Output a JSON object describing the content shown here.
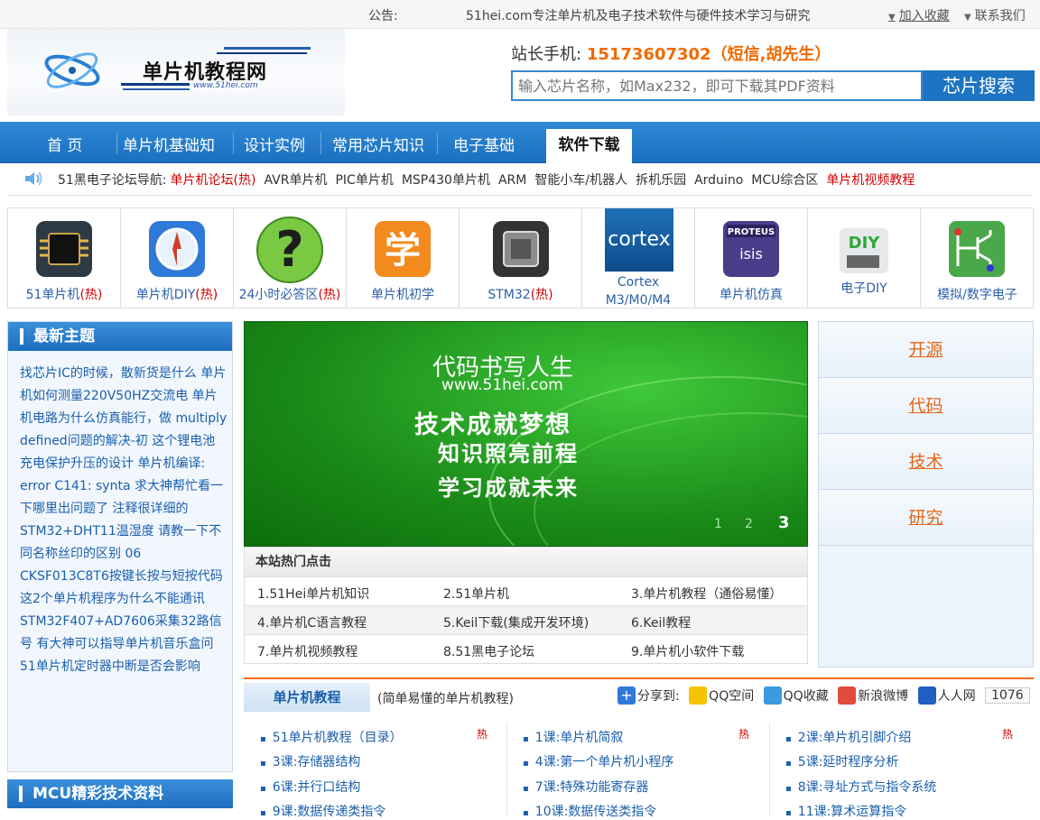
{
  "topbar": {
    "notice_label": "公告:",
    "notice_text": "51hei.com专注单片机及电子技术软件与硬件技术学习与研究",
    "add_favorite": "加入收藏",
    "contact": "联系我们"
  },
  "logo": {
    "name": "单片机教程网",
    "url_text": "www.51hei.com"
  },
  "contact_line": {
    "label": "站长手机:",
    "value": "15173607302（短信,胡先生）"
  },
  "search": {
    "placeholder": "输入芯片名称，如Max232，即可下载其PDF资料",
    "button": "芯片搜索"
  },
  "nav": {
    "items": [
      "首 页",
      "单片机基础知",
      "设计实例",
      "常用芯片知识",
      "电子基础"
    ],
    "active": "软件下载"
  },
  "forum_nav": {
    "label": "51黑电子论坛导航:",
    "links": [
      "单片机论坛(热)",
      "AVR单片机",
      "PIC单片机",
      "MSP430单片机",
      "ARM",
      "智能小车/机器人",
      "拆机乐园",
      "Arduino",
      "MCU综合区",
      "单片机视频教程"
    ]
  },
  "icon_row": [
    {
      "label": "51单片机",
      "hot": "(热)"
    },
    {
      "label": "单片机DIY",
      "hot": "(热)"
    },
    {
      "label": "24小时必答区",
      "hot": "(热)"
    },
    {
      "label": "单片机初学",
      "hot": ""
    },
    {
      "label": "STM32",
      "hot": "(热)"
    },
    {
      "label": "Cortex M3/M0/M4",
      "hot": ""
    },
    {
      "label": "单片机仿真",
      "hot": ""
    },
    {
      "label": "电子DIY",
      "hot": ""
    },
    {
      "label": "模拟/数字电子",
      "hot": ""
    }
  ],
  "icon_glyphs": {
    "xue": "学",
    "cortex": "cortex",
    "proteus": "PROTEUS",
    "isis": "isis",
    "diy": "DIY"
  },
  "latest": {
    "title": "最新主题",
    "text": "找芯片IC的时候，散新货是什么 单片机如何测量220V50HZ交流电 单片机电路为什么仿真能行，做 multiply defined问题的解决-初 这个锂电池充电保护升压的设计 单片机编译: error C141: synta 求大神帮忙看一下哪里出问题了 注释很详细的STM32+DHT11温湿度 请教一下不同名称丝印的区别 06 CKSF013C8T6按键长按与短按代码 这2个单片机程序为什么不能通讯 STM32F407+AD7606采集32路信号 有大神可以指导单片机音乐盒问 51单片机定时器中断是否会影响"
  },
  "mcu_section": {
    "title": "MCU精彩技术资料"
  },
  "banner": {
    "line1": "代码书写人生",
    "line2": "www.51hei.com",
    "line3": "技术成就梦想",
    "line4": "知识照亮前程",
    "line5": "学习成就未来",
    "pages": [
      "1",
      "2",
      "3"
    ]
  },
  "hot_clicks": {
    "title": "本站热门点击",
    "items": [
      "1.51Hei单片机知识",
      "2.51单片机",
      "3.单片机教程（通俗易懂）",
      "4.单片机C语言教程",
      "5.Keil下载(集成开发环境)",
      "6.Keil教程",
      "7.单片机视频教程",
      "8.51黑电子论坛",
      "9.单片机小软件下载"
    ]
  },
  "tags": [
    "开源",
    "代码",
    "技术",
    "研究"
  ],
  "tutorial": {
    "tab": "单片机教程",
    "subtitle": "(简单易懂的单片机教程)",
    "share_label": "分享到:",
    "share": [
      "QQ空间",
      "QQ收藏",
      "新浪微博",
      "人人网"
    ],
    "count": "1076",
    "hot_mark": "热",
    "lessons": [
      "51单片机教程（目录）",
      "1课:单片机简叙",
      "2课:单片机引脚介绍",
      "3课:存储器结构",
      "4课:第一个单片机小程序",
      "5课:延时程序分析",
      "6课:并行口结构",
      "7课:特殊功能寄存器",
      "8课:寻址方式与指令系统",
      "9课:数据传递类指令",
      "10课:数据传送类指令",
      "11课:算术运算指令"
    ]
  },
  "colors": {
    "nav_blue": "#1b6fbf",
    "hot_red": "#d40000",
    "phone_orange": "#f06a00",
    "tag_orange": "#e2661b",
    "banner_green": "#1a8a18"
  }
}
